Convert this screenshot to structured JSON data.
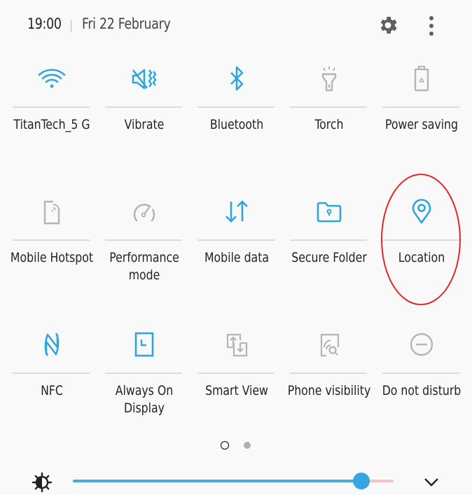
{
  "header": {
    "time": "19:00",
    "date": "Fri 22 February",
    "settings_icon": "gear-icon",
    "more_icon": "more-vertical-icon"
  },
  "colors": {
    "active": "#2ea6dd",
    "inactive": "#b5b5b5",
    "annotation": "#e32424",
    "slider_fill": "#4fa9d6",
    "slider_rest": "#f0c6c6"
  },
  "tiles": [
    {
      "label": "TitanTech_5 G",
      "icon": "wifi-icon",
      "active": true
    },
    {
      "label": "Vibrate",
      "icon": "vibrate-icon",
      "active": true
    },
    {
      "label": "Bluetooth",
      "icon": "bluetooth-icon",
      "active": true
    },
    {
      "label": "Torch",
      "icon": "torch-icon",
      "active": false
    },
    {
      "label": "Power saving",
      "icon": "power-saving-icon",
      "active": false
    },
    {
      "label": "Mobile Hotspot",
      "icon": "hotspot-icon",
      "active": false
    },
    {
      "label": "Performance mode",
      "icon": "performance-icon",
      "active": false
    },
    {
      "label": "Mobile data",
      "icon": "mobile-data-icon",
      "active": true
    },
    {
      "label": "Secure Folder",
      "icon": "secure-folder-icon",
      "active": true
    },
    {
      "label": "Location",
      "icon": "location-icon",
      "active": true,
      "highlighted": true
    },
    {
      "label": "NFC",
      "icon": "nfc-icon",
      "active": true
    },
    {
      "label": "Always On Display",
      "icon": "always-on-display-icon",
      "active": true
    },
    {
      "label": "Smart View",
      "icon": "smart-view-icon",
      "active": false
    },
    {
      "label": "Phone visibility",
      "icon": "phone-visibility-icon",
      "active": false
    },
    {
      "label": "Do not disturb",
      "icon": "do-not-disturb-icon",
      "active": false
    }
  ],
  "pager": {
    "pages": 2,
    "current": 1
  },
  "brightness": {
    "value_percent": 90,
    "icon": "brightness-icon",
    "expand_icon": "chevron-down-icon"
  }
}
